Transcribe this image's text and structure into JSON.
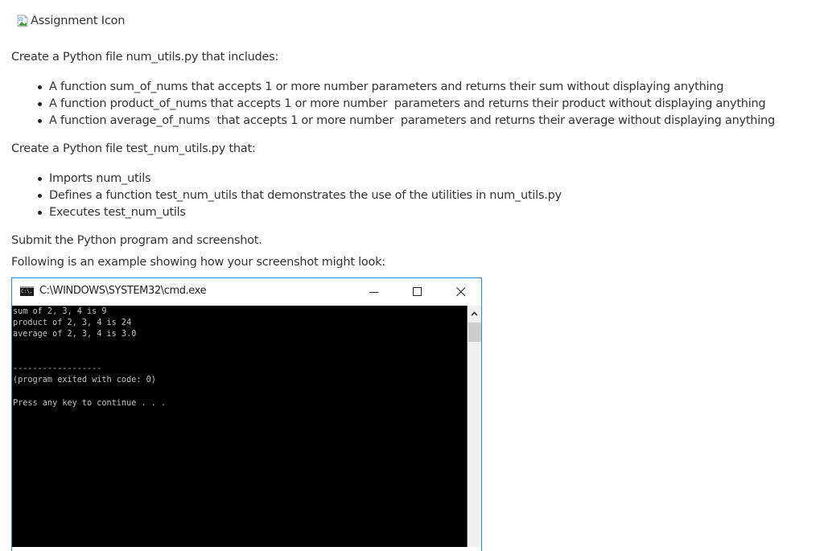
{
  "assignment_icon": {
    "alt_text": "Assignment Icon",
    "icon": "broken-image-icon"
  },
  "section1": {
    "intro": "Create a Python file num_utils.py that includes:",
    "items": [
      "A function sum_of_nums that accepts 1 or more number parameters and returns their sum without displaying anything",
      "A function product_of_nums that accepts 1 or more number  parameters and returns their product without displaying anything",
      "A function average_of_nums  that accepts 1 or more number  parameters and returns their average without displaying anything"
    ]
  },
  "section2": {
    "intro": "Create a Python file test_num_utils.py that:",
    "items": [
      "Imports num_utils",
      "Defines a function test_num_utils that demonstrates the use of the utilities in num_utils.py",
      "Executes test_num_utils"
    ]
  },
  "submit_text": "Submit the Python program and screenshot.",
  "example_text": "Following is an example showing how your screenshot might look:",
  "cmd_window": {
    "title": "C:\\WINDOWS\\SYSTEM32\\cmd.exe",
    "icon_label": "C:\\.",
    "controls": {
      "minimize": "minimize-icon",
      "maximize": "maximize-icon",
      "close": "close-icon"
    },
    "colors": {
      "border": "#2b8bd8",
      "console_bg": "#000000",
      "console_text": "#c0c0c0"
    },
    "output_lines": [
      "sum of 2, 3, 4 is 9",
      "product of 2, 3, 4 is 24",
      "average of 2, 3, 4 is 3.0",
      "",
      "",
      "------------------",
      "(program exited with code: 0)",
      "",
      "Press any key to continue . . ."
    ]
  }
}
